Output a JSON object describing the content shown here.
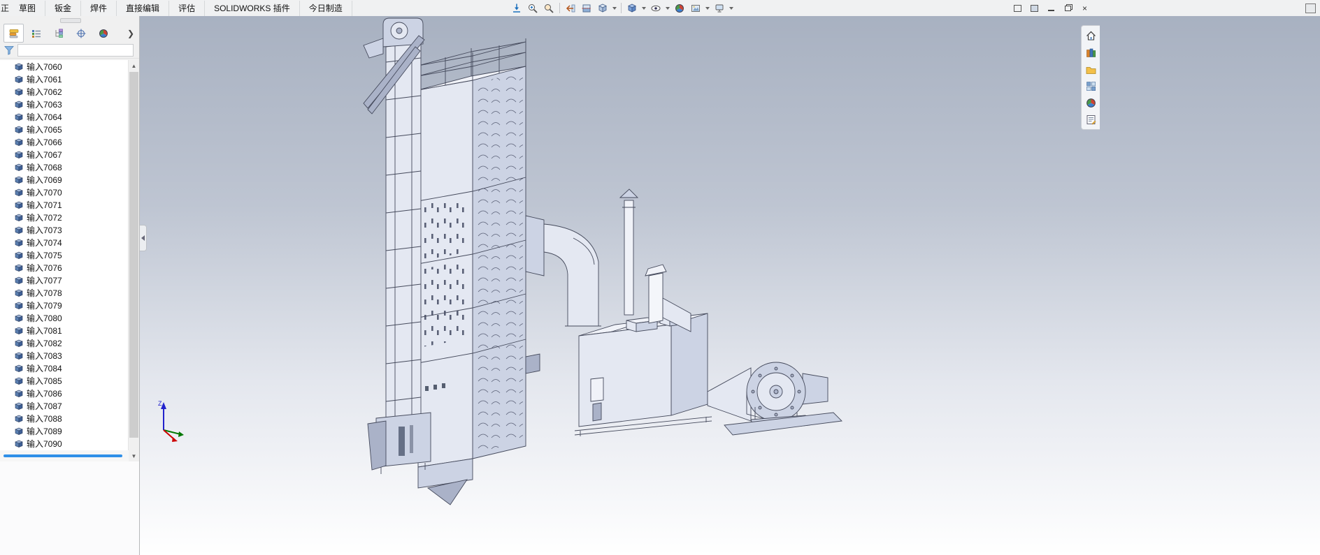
{
  "window": {
    "partial_left_label": "正",
    "menu_tabs": [
      "草图",
      "钣金",
      "焊件",
      "直接编辑",
      "评估",
      "SOLIDWORKS 插件",
      "今日制造"
    ],
    "controls": [
      "undock-pane-icon",
      "pin-pane-icon",
      "minimize-button",
      "restore-button",
      "close-button"
    ],
    "corner_icon": "expand-toolbar-icon"
  },
  "heads_up_toolbar": {
    "icons": [
      "zoom-to-fit-icon",
      "zoom-area-icon",
      "magnify-icon",
      "previous-view-icon",
      "section-view-icon",
      "view-orientation-icon",
      "display-style-icon",
      "hide-show-items-icon",
      "edit-appearance-icon",
      "apply-scene-icon",
      "view-settings-icon"
    ]
  },
  "sidebar": {
    "tabs": [
      "featuremanager-design-tree-tab",
      "propertymanager-tab",
      "configurationmanager-tab",
      "dimxpertmanager-tab",
      "displaymanager-tab"
    ],
    "overflow_chevron": "❯",
    "filter": {
      "value": "",
      "placeholder": ""
    },
    "scrollbar": {
      "up_arrow": "▲",
      "down_arrow": "▼"
    },
    "tree_items": [
      "输入7060",
      "输入7061",
      "输入7062",
      "输入7063",
      "输入7064",
      "输入7065",
      "输入7066",
      "输入7067",
      "输入7068",
      "输入7069",
      "输入7070",
      "输入7071",
      "输入7072",
      "输入7073",
      "输入7074",
      "输入7075",
      "输入7076",
      "输入7077",
      "输入7078",
      "输入7079",
      "输入7080",
      "输入7081",
      "输入7082",
      "输入7083",
      "输入7084",
      "输入7085",
      "输入7086",
      "输入7087",
      "输入7088",
      "输入7089",
      "输入7090"
    ]
  },
  "task_pane": {
    "icons": [
      "home-icon",
      "design-library-icon",
      "file-explorer-icon",
      "view-palette-icon",
      "appearances-icon",
      "custom-properties-icon"
    ]
  },
  "viewport": {
    "triad_labels": {
      "z": "Z"
    },
    "colors": {
      "bg_top": "#a8b1c1",
      "bg_bottom": "#ffffff",
      "model_face_light": "#e4e8f2",
      "model_face_mid": "#ccd3e4",
      "model_face_dark": "#aab2c8",
      "outline": "#454a5c",
      "accent_scrollbar": "#2f8fe8"
    }
  }
}
